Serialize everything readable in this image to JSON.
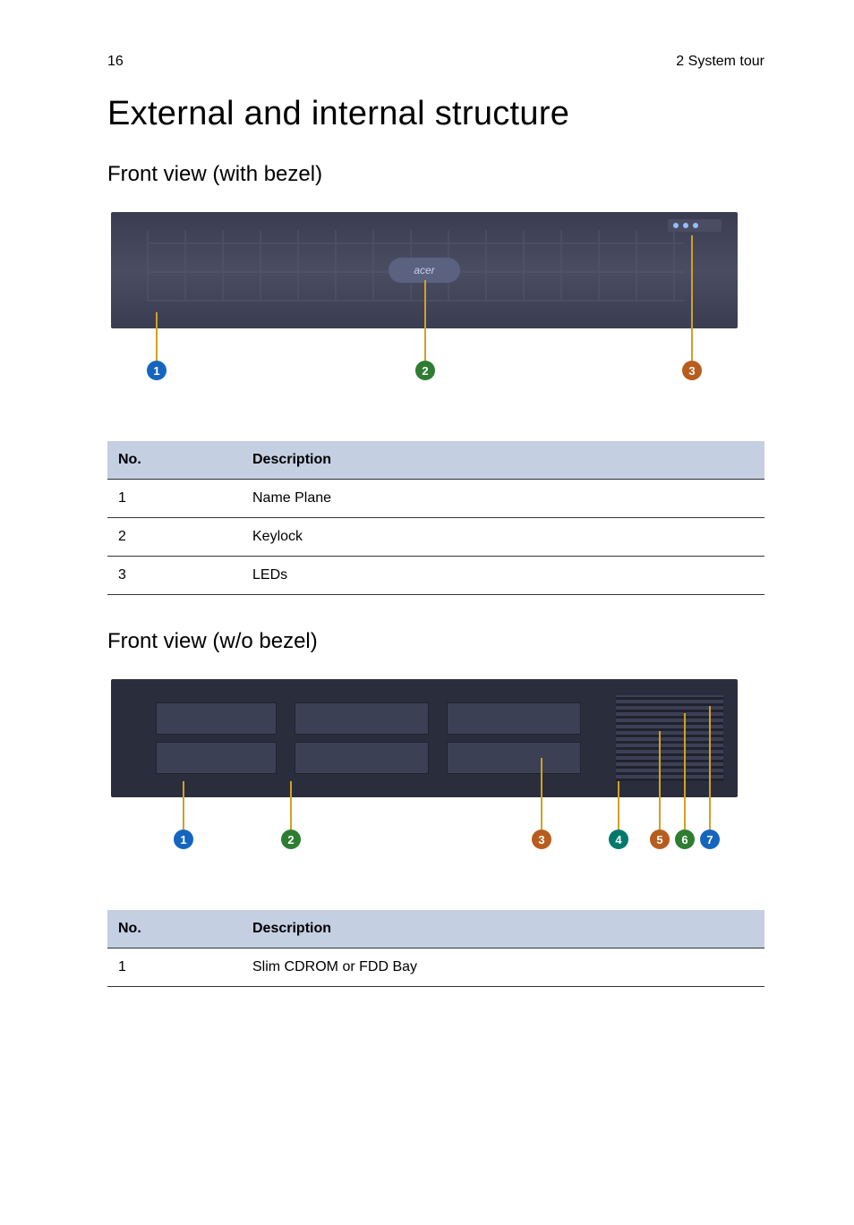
{
  "header": {
    "page_number": "16",
    "section": "2 System tour"
  },
  "title": "External and internal structure",
  "section1": {
    "heading": "Front view (with bezel)",
    "brand_label": "acer",
    "callouts": [
      "1",
      "2",
      "3"
    ],
    "table": {
      "col_no": "No.",
      "col_desc": "Description",
      "rows": [
        {
          "no": "1",
          "desc": "Name Plane"
        },
        {
          "no": "2",
          "desc": "Keylock"
        },
        {
          "no": "3",
          "desc": "LEDs"
        }
      ]
    }
  },
  "section2": {
    "heading": "Front view (w/o bezel)",
    "callouts": [
      "1",
      "2",
      "3",
      "4",
      "5",
      "6",
      "7"
    ],
    "table": {
      "col_no": "No.",
      "col_desc": "Description",
      "rows": [
        {
          "no": "1",
          "desc": "Slim CDROM or FDD Bay"
        }
      ]
    }
  }
}
